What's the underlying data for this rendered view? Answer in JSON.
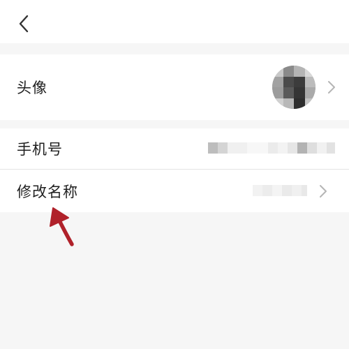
{
  "header": {
    "back_icon": "chevron-left-icon"
  },
  "profile": {
    "avatar_label": "头像",
    "phone_label": "手机号",
    "rename_label": "修改名称"
  },
  "icons": {
    "chevron": "chevron-right-icon",
    "annotation": "red-arrow-icon"
  },
  "colors": {
    "background": "#f6f6f6",
    "card": "#ffffff",
    "text": "#1f1f1f",
    "annotation": "#b0212a"
  }
}
